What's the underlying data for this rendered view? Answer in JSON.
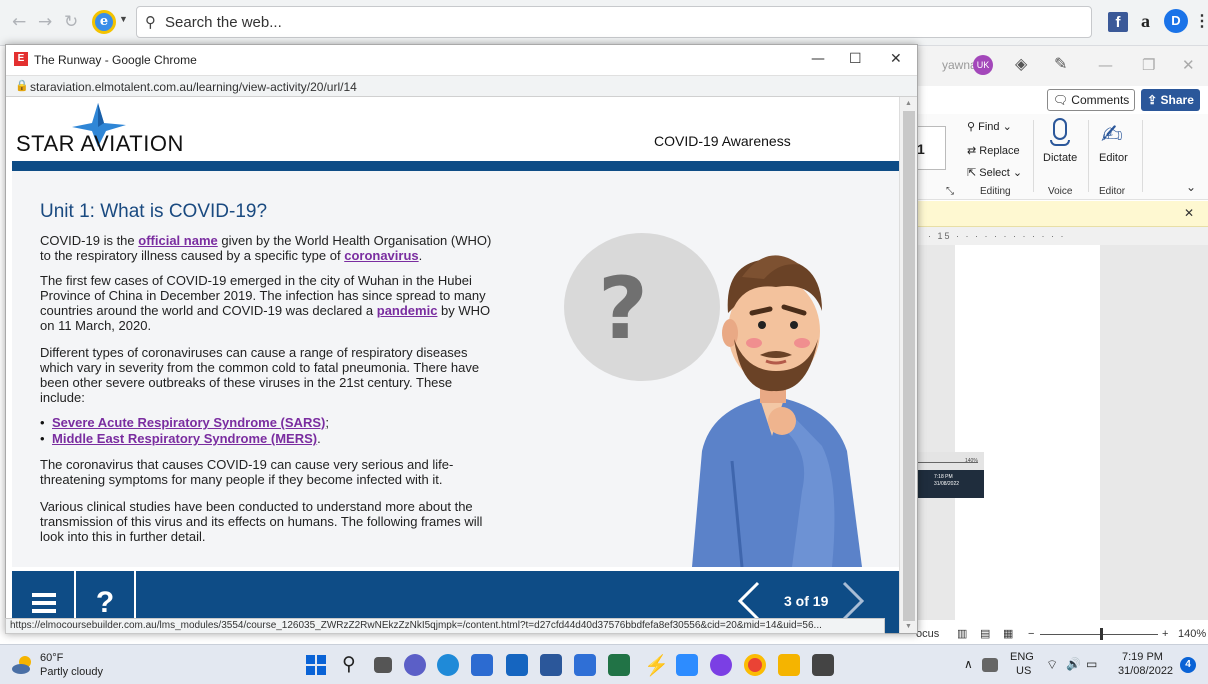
{
  "outer_browser": {
    "search_placeholder": "Search the web...",
    "ext_fb": "f",
    "ext_amazon": "a",
    "ext_d": "D",
    "menu": "⋮"
  },
  "word": {
    "user": "yawnaing",
    "avatar": "UK",
    "comments": "Comments",
    "share": "Share",
    "find": "Find",
    "replace": "Replace",
    "select": "Select",
    "editing": "Editing",
    "dictate": "Dictate",
    "voice": "Voice",
    "editor": "Editor",
    "editor_group": "Editor",
    "ruler": "· 15 · · · · · · · · · · · ·",
    "status_focus": "ocus",
    "zoom": "140%",
    "thumb_zoom": "140%",
    "thumb_time": "7:18 PM",
    "thumb_date": "31/08/2022"
  },
  "popup": {
    "title": "The Runway - Google Chrome",
    "favicon": "E",
    "url": "staraviation.elmotalent.com.au/learning/view-activity/20/url/14",
    "status_url": "https://elmocoursebuilder.com.au/lms_modules/3554/course_126035_ZWRzZ2RwNEkzZzNkI5qjmpk=/content.html?t=d27cfd44d40d37576bbdfefa8ef30556&cid=20&mid=14&uid=56..."
  },
  "course": {
    "logo": "STAR AVIATION",
    "title": "COVID-19 Awareness",
    "unit_title": "Unit 1: What is COVID-19?",
    "p1_a": "COVID-19 is the ",
    "p1_link": "official name",
    "p1_b": " given by the World Health Organisation (WHO) to the respiratory illness caused by a specific type of ",
    "p1_link2": "coronavirus",
    "p1_c": ".",
    "p2_a": "The first few cases of COVID-19 emerged in the city of Wuhan in the Hubei Province of China in December 2019. The infection has since spread to many countries around the world and COVID-19 was declared a ",
    "p2_link": "pandemic",
    "p2_b": " by WHO on 11 March, 2020.",
    "p3": "Different types of coronaviruses can cause a range of respiratory diseases which vary in severity from the common cold to fatal pneumonia. There have been other severe outbreaks of these viruses in the 21st century. These include:",
    "bullet1": "Severe Acute Respiratory Syndrome (SARS)",
    "bullet1_tail": ";",
    "bullet2": "Middle East Respiratory Syndrome (MERS)",
    "bullet2_tail": ".",
    "p4": "The coronavirus that causes COVID-19 can cause very serious and life-threatening symptoms for many people if they become infected with it.",
    "p5": "Various clinical studies have been conducted to understand more about the transmission of this virus and its effects on humans. The following frames will look into this in further detail.",
    "help": "?",
    "pager": "3 of 19"
  },
  "taskbar": {
    "temp": "60°F",
    "weather": "Partly cloudy",
    "lang": "ENG",
    "region": "US",
    "time": "7:19 PM",
    "date": "31/08/2022",
    "notifications": "4"
  },
  "colors": {
    "brand_blue": "#0e4c86",
    "link_purple": "#7a2da0",
    "word_blue": "#2b579a"
  }
}
